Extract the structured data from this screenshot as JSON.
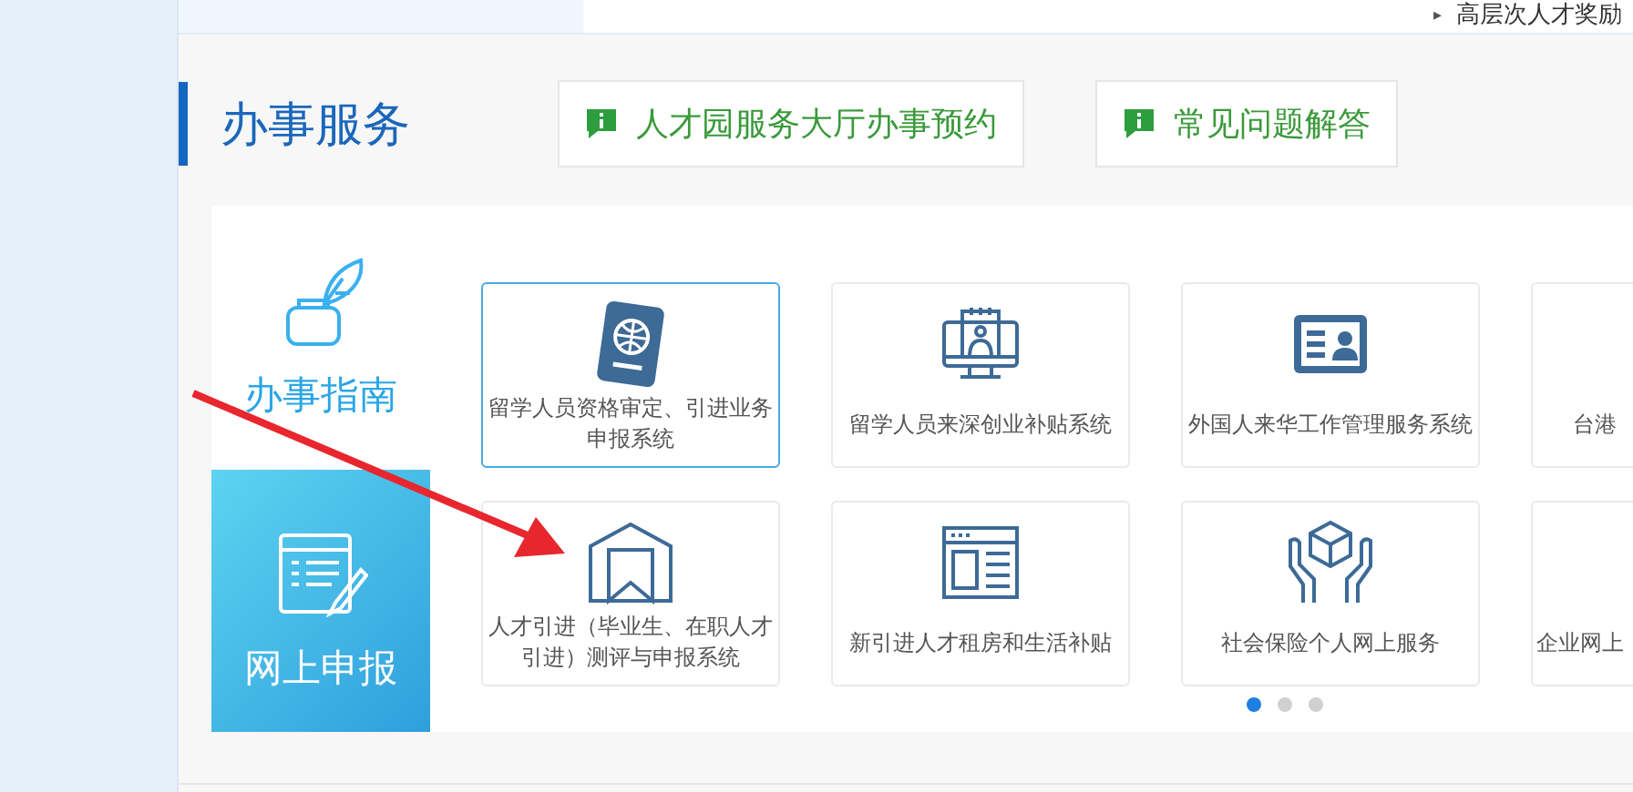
{
  "top_link": {
    "bullet": "▸",
    "text": "高层次人才奖励"
  },
  "section": {
    "title": "办事服务"
  },
  "header_buttons": [
    {
      "label": "人才园服务大厅办事预约"
    },
    {
      "label": "常见问题解答"
    }
  ],
  "tabs": [
    {
      "label": "办事指南",
      "kind": "guide",
      "selected": false
    },
    {
      "label": "网上申报",
      "kind": "form",
      "selected": true
    }
  ],
  "cards": [
    {
      "label": "留学人员资格审定、引进业务申报系统",
      "kind": "passport",
      "selected": true
    },
    {
      "label": "留学人员来深创业补贴系统",
      "kind": "monitor",
      "selected": false
    },
    {
      "label": "外国人来华工作管理服务系统",
      "kind": "idcard",
      "selected": false
    },
    {
      "label": "台港",
      "kind": "cut",
      "selected": false
    },
    {
      "label": "人才引进（毕业生、在职人才引进）测评与申报系统",
      "kind": "house",
      "selected": false
    },
    {
      "label": "新引进人才租房和生活补贴",
      "kind": "webpage",
      "selected": false
    },
    {
      "label": "社会保险个人网上服务",
      "kind": "hands",
      "selected": false
    },
    {
      "label": "企业网上",
      "kind": "cut",
      "selected": false
    }
  ],
  "pager": [
    {
      "selected": true
    },
    {
      "selected": false
    },
    {
      "selected": false
    }
  ],
  "annotation": {
    "kind": "arrow"
  }
}
